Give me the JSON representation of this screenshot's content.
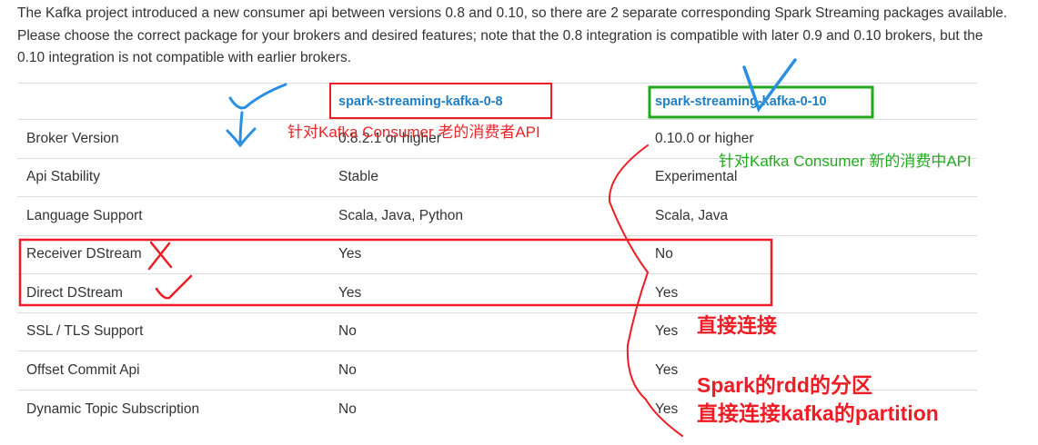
{
  "intro": {
    "text": "The Kafka project introduced a new consumer api between versions 0.8 and 0.10, so there are 2 separate corresponding Spark Streaming packages available. Please choose the correct package for your brokers and desired features; note that the 0.8 integration is compatible with later 0.9 and 0.10 brokers, but the 0.10 integration is not compatible with earlier brokers."
  },
  "table": {
    "headers": [
      "",
      "spark-streaming-kafka-0-8",
      "spark-streaming-kafka-0-10"
    ],
    "rows": [
      [
        "Broker Version",
        "0.8.2.1 or higher",
        "0.10.0 or higher"
      ],
      [
        "Api Stability",
        "Stable",
        "Experimental"
      ],
      [
        "Language Support",
        "Scala, Java, Python",
        "Scala, Java"
      ],
      [
        "Receiver DStream",
        "Yes",
        "No"
      ],
      [
        "Direct DStream",
        "Yes",
        "Yes"
      ],
      [
        "SSL / TLS Support",
        "No",
        "Yes"
      ],
      [
        "Offset Commit Api",
        "No",
        "Yes"
      ],
      [
        "Dynamic Topic Subscription",
        "No",
        "Yes"
      ]
    ]
  },
  "annotations": {
    "old_consumer": "针对Kafka Consumer 老的消费者API",
    "new_consumer": "针对Kafka Consumer 新的消费中API",
    "direct_connect": "直接连接",
    "rdd_partition_line1": "Spark的rdd的分区",
    "rdd_partition_line2": "直接连接kafka的partition"
  },
  "colors": {
    "link_blue": "#1f7fc4",
    "annotation_red": "#ee1c25",
    "annotation_green": "#21a91d",
    "annotation_blue": "#2a8fe0"
  }
}
